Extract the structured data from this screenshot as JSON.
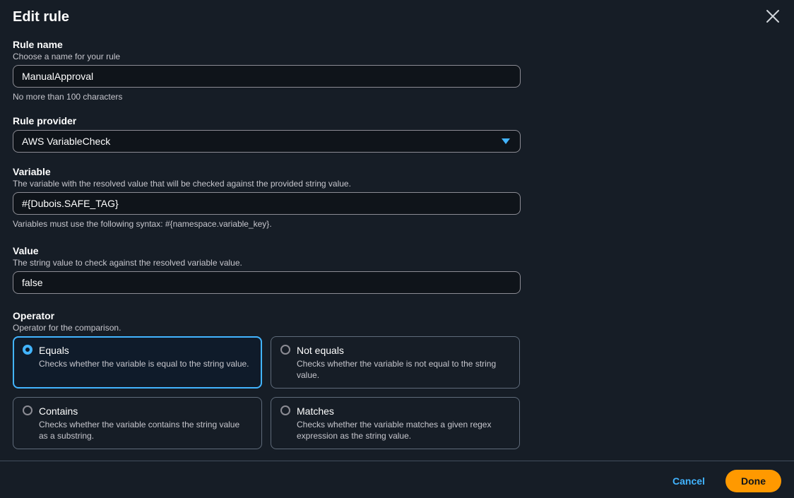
{
  "modal": {
    "title": "Edit rule",
    "close_icon": "close-icon"
  },
  "rule_name": {
    "label": "Rule name",
    "description": "Choose a name for your rule",
    "value": "ManualApproval",
    "constraint": "No more than 100 characters"
  },
  "rule_provider": {
    "label": "Rule provider",
    "selected": "AWS VariableCheck",
    "caret_icon": "caret-down-icon"
  },
  "variable": {
    "label": "Variable",
    "description": "The variable with the resolved value that will be checked against the provided string value.",
    "value": "#{Dubois.SAFE_TAG}",
    "constraint": "Variables must use the following syntax: #{namespace.variable_key}."
  },
  "value_field": {
    "label": "Value",
    "description": "The string value to check against the resolved variable value.",
    "value": "false"
  },
  "operator": {
    "label": "Operator",
    "description": "Operator for the comparison.",
    "selected": "equals",
    "options": [
      {
        "id": "equals",
        "title": "Equals",
        "description": "Checks whether the variable is equal to the string value."
      },
      {
        "id": "not_equals",
        "title": "Not equals",
        "description": "Checks whether the variable is not equal to the string value."
      },
      {
        "id": "contains",
        "title": "Contains",
        "description": "Checks whether the variable contains the string value as a substring."
      },
      {
        "id": "matches",
        "title": "Matches",
        "description": "Checks whether the variable matches a given regex expression as the string value."
      }
    ]
  },
  "footer": {
    "cancel_label": "Cancel",
    "done_label": "Done"
  },
  "colors": {
    "background": "#161d26",
    "accent": "#42b4ff",
    "primary_button": "#ff9900",
    "input_border": "#8c8c94"
  }
}
